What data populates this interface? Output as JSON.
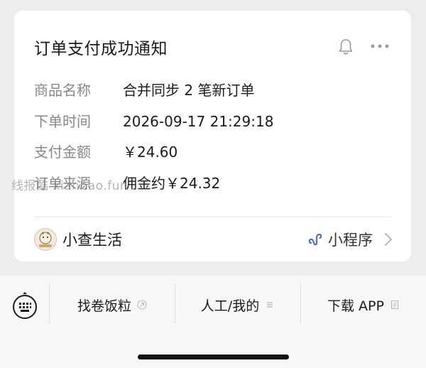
{
  "card": {
    "title": "订单支付成功通知",
    "rows": [
      {
        "label": "商品名称",
        "value": "合并同步 2 笔新订单"
      },
      {
        "label": "下单时间",
        "value": "2026-09-17 21:29:18"
      },
      {
        "label": "支付金额",
        "value": "￥24.60"
      },
      {
        "label": "订单来源",
        "value": "佣金约￥24.32"
      }
    ],
    "brand_name": "小查生活",
    "mini_program_label": "小程序"
  },
  "watermark": "线报酷 xianbao.fun",
  "menu": {
    "items": [
      {
        "label": "找卷饭粒"
      },
      {
        "label": "人工/我的"
      },
      {
        "label": "下载 APP"
      }
    ]
  },
  "icons": {
    "bell": "bell-icon",
    "more": "more-icon",
    "mini_program": "mini-program-icon",
    "chevron": "chevron-right-icon",
    "keyboard": "keyboard-icon",
    "link": "link-icon",
    "list": "list-icon",
    "doc": "doc-icon"
  },
  "colors": {
    "page_bg": "#ededed",
    "card_bg": "#ffffff",
    "label_gray": "#888888",
    "mini_program_blue": "#4a6fd8"
  }
}
